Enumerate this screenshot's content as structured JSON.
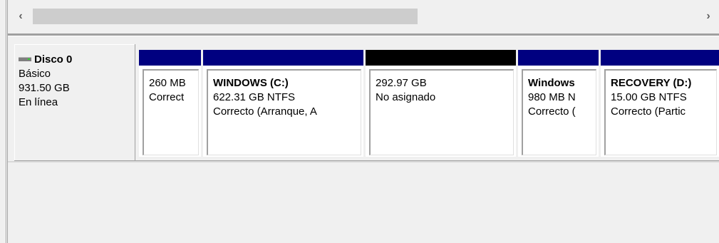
{
  "scrollbar": {
    "left_arrow": "‹",
    "right_arrow": "›"
  },
  "disk": {
    "name": "Disco 0",
    "type": "Básico",
    "size": "931.50 GB",
    "status": "En línea"
  },
  "partitions": [
    {
      "title": "",
      "line1": "260 MB",
      "line2": "Correct",
      "bar_color": "#000080"
    },
    {
      "title": "WINDOWS  (C:)",
      "line1": "622.31 GB NTFS",
      "line2": "Correcto (Arranque, A",
      "bar_color": "#000080"
    },
    {
      "title": "",
      "line1": "292.97 GB",
      "line2": "No asignado",
      "bar_color": "#000000"
    },
    {
      "title": "Windows",
      "line1": "980 MB N",
      "line2": "Correcto (",
      "bar_color": "#000080"
    },
    {
      "title": "RECOVERY  (D:)",
      "line1": "15.00 GB NTFS",
      "line2": "Correcto (Partic",
      "bar_color": "#000080"
    }
  ]
}
